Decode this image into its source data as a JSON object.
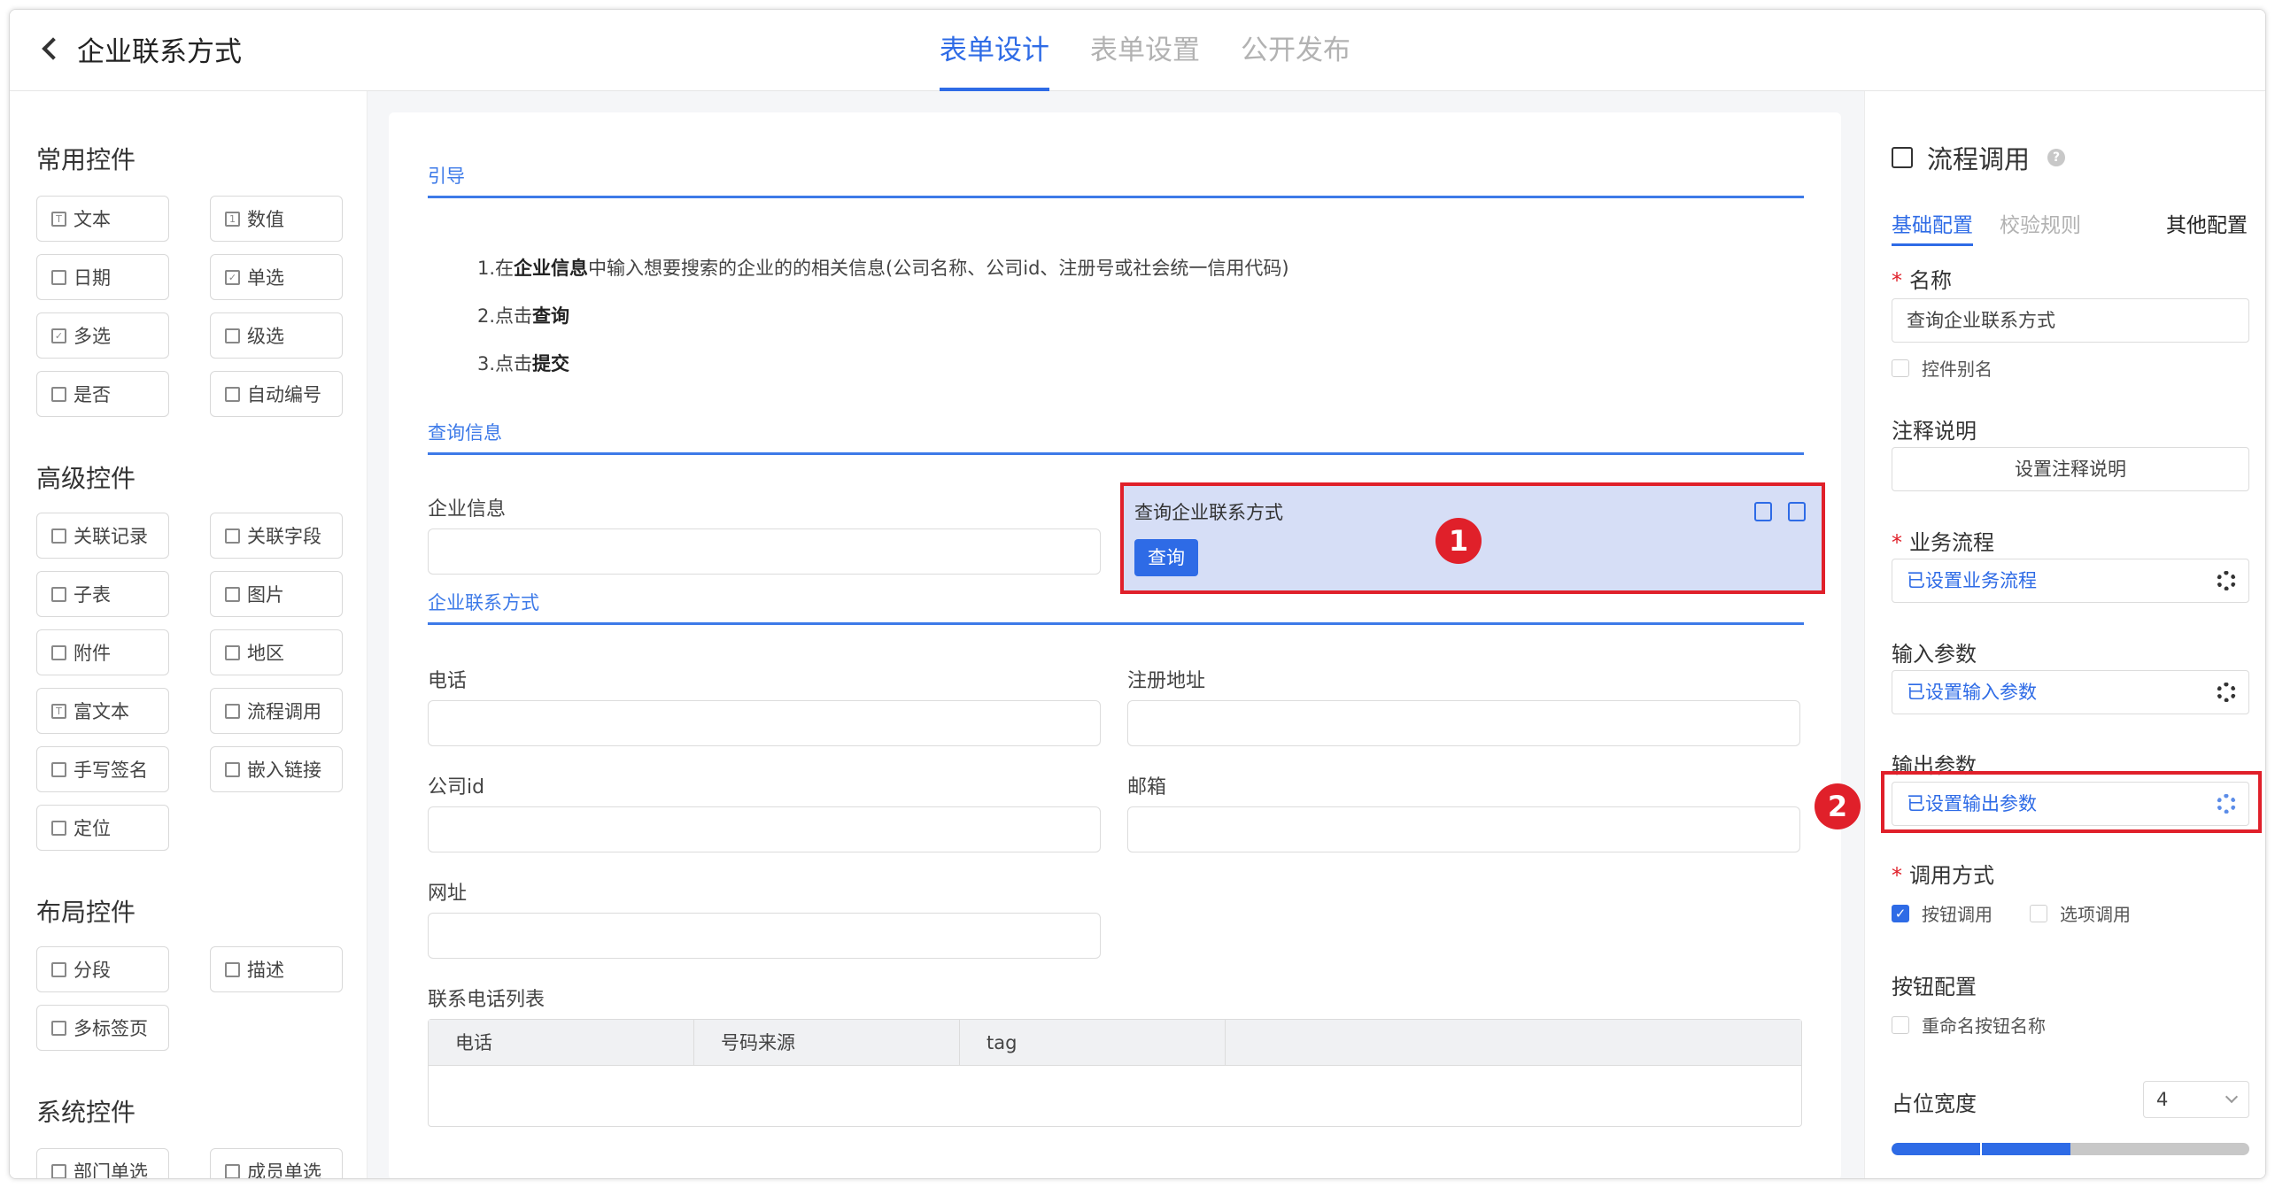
{
  "header": {
    "page_title": "企业联系方式",
    "tabs": [
      "表单设计",
      "表单设置",
      "公开发布"
    ]
  },
  "palette": {
    "groups": [
      {
        "title": "常用控件",
        "items": [
          "文本",
          "数值",
          "日期",
          "单选",
          "多选",
          "级选",
          "是否",
          "自动编号"
        ]
      },
      {
        "title": "高级控件",
        "items": [
          "关联记录",
          "关联字段",
          "子表",
          "图片",
          "附件",
          "地区",
          "富文本",
          "流程调用",
          "手写签名",
          "嵌入链接",
          "定位"
        ]
      },
      {
        "title": "布局控件",
        "items": [
          "分段",
          "描述",
          "多标签页"
        ]
      },
      {
        "title": "系统控件",
        "items": [
          "部门单选",
          "成员单选"
        ]
      }
    ]
  },
  "canvas": {
    "guide_section": "引导",
    "guide_lines": {
      "l1_a": "1.在",
      "l1_b": "企业信息",
      "l1_c": "中输入想要搜索的企业的的相关信息(公司名称、公司id、注册号或社会统一信用代码)",
      "l2_a": "2.点击",
      "l2_b": "查询",
      "l3_a": "3.点击",
      "l3_b": "提交"
    },
    "query_section": "查询信息",
    "company_info_label": "企业信息",
    "selected_widget": {
      "title": "查询企业联系方式",
      "button": "查询"
    },
    "contact_section": "企业联系方式",
    "fields": {
      "phone": "电话",
      "address": "注册地址",
      "company_id": "公司id",
      "email": "邮箱",
      "website": "网址"
    },
    "table": {
      "title": "联系电话列表",
      "columns": [
        "电话",
        "号码来源",
        "tag"
      ]
    },
    "badges": [
      "1",
      "2"
    ]
  },
  "panel": {
    "title": "流程调用",
    "tabs": [
      "基础配置",
      "校验规则",
      "其他配置"
    ],
    "name_label": "名称",
    "name_value": "查询企业联系方式",
    "alias_label": "控件别名",
    "note_label": "注释说明",
    "note_button": "设置注释说明",
    "flow_label": "业务流程",
    "flow_value": "已设置业务流程",
    "input_label": "输入参数",
    "input_value": "已设置输入参数",
    "output_label": "输出参数",
    "output_value": "已设置输出参数",
    "call_label": "调用方式",
    "call_options": [
      "按钮调用",
      "选项调用"
    ],
    "button_config_label": "按钮配置",
    "rename_label": "重命名按钮名称",
    "width_label": "占位宽度",
    "width_value": "4",
    "width_fraction": 0.5
  },
  "colors": {
    "accent": "#2e6be6",
    "highlight": "#e0202a",
    "selected_bg": "#d6def6"
  }
}
